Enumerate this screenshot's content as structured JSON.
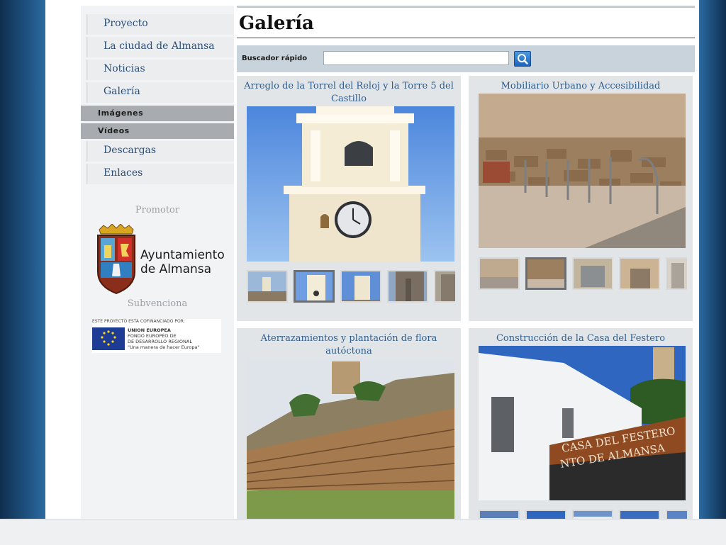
{
  "nav": {
    "items": [
      {
        "label": "Proyecto"
      },
      {
        "label": "La ciudad de Almansa"
      },
      {
        "label": "Noticias"
      },
      {
        "label": "Galería"
      }
    ],
    "subitems": [
      {
        "label": "Imágenes"
      },
      {
        "label": "Vídeos"
      }
    ],
    "items_after": [
      {
        "label": "Descargas"
      },
      {
        "label": "Enlaces"
      }
    ]
  },
  "sidebar": {
    "promotor_label": "Promotor",
    "logo_line1": "Ayuntamiento",
    "logo_line2": "de Almansa",
    "subvenciona_label": "Subvenciona",
    "eu_caption": "ESTE PROYECTO ESTA COFINANCIADO POR:",
    "eu_line1": "UNION EUROPEA",
    "eu_line2": "FONDO EUROPEO DE",
    "eu_line3": "DE DESARROLLO REGIONAL",
    "eu_line4": "\"Una manera de hacer Europa\""
  },
  "page": {
    "title": "Galería"
  },
  "search": {
    "label": "Buscador rápido",
    "value": ""
  },
  "gallery": [
    {
      "title": "Arreglo de la Torrel del Reloj y la Torre 5 del Castillo",
      "thumb_count": 5,
      "selected": 1
    },
    {
      "title": "Mobiliario Urbano y Accesibilidad",
      "thumb_count": 5,
      "selected": 1
    },
    {
      "title": "Aterrazamientos y plantación de flora autóctona",
      "thumb_count": 0,
      "selected": -1
    },
    {
      "title": "Construcción de la Casa del Festero",
      "thumb_count": 5,
      "selected": -1
    }
  ],
  "photo_text": {
    "festero_line1": "CASA DEL FESTERO",
    "festero_line2": "NTO DE ALMANSA"
  },
  "colors": {
    "nav_text": "#2b4f78",
    "card_title": "#2e5d8c",
    "side_band": "#1d4f7d"
  }
}
